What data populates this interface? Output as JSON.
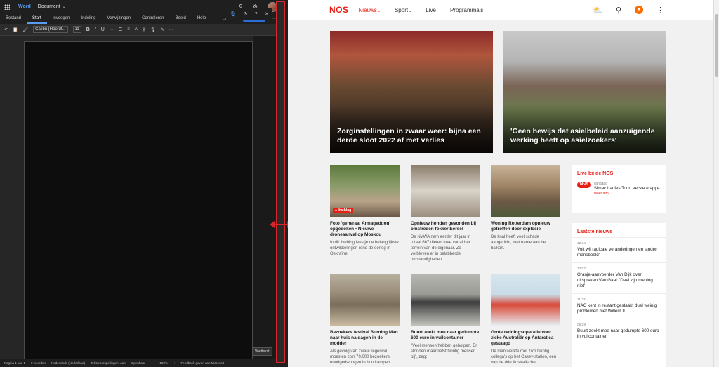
{
  "word": {
    "app_name": "Word",
    "doc_title": "Document",
    "tabs": [
      "Bestand",
      "Start",
      "Invoegen",
      "Indeling",
      "Verwijzingen",
      "Controleren",
      "Beeld",
      "Help"
    ],
    "active_tab": "Start",
    "share_label": "Delen",
    "font_name": "Calibri (Hoofdt...",
    "font_size": "11",
    "footer_button": "Voettekst",
    "status": {
      "page": "Pagina 1 van 1",
      "words": "0 woorden",
      "language": "Nederlands (Nederland)",
      "predictions": "Tekstvoorspellingen: Aan",
      "focus": "Openbaar",
      "zoom": "100%",
      "feedback": "Feedback geven aan Microsoft"
    }
  },
  "nos": {
    "logo": "NOS",
    "nav": [
      {
        "label": "Nieuws",
        "has_dropdown": true,
        "active": true
      },
      {
        "label": "Sport",
        "has_dropdown": true,
        "active": false
      },
      {
        "label": "Live",
        "has_dropdown": false,
        "active": false
      },
      {
        "label": "Programma's",
        "has_dropdown": false,
        "active": false
      }
    ],
    "icons": [
      "weather-icon",
      "search-icon",
      "npo-icon",
      "more-icon"
    ],
    "accent_color": "#e61e14",
    "heroes": [
      {
        "title": "Zorginstellingen in zwaar weer: bijna een derde sloot 2022 af met verlies"
      },
      {
        "title": "'Geen bewijs dat asielbeleid aanzuigende werking heeft op asielzoekers'"
      }
    ],
    "cards": [
      {
        "title": "Foto 'generaal Armageddon' opgedoken • Nieuwe droneaanval op Moskou",
        "text": "In dit liveblog lees je de belangrijkste ontwikkelingen rond de oorlog in Oekraïne.",
        "badge": "liveblog"
      },
      {
        "title": "Opnieuw honden gevonden bij omstreden fokker Eersel",
        "text": "De NVWA nam eerder dit jaar in totaal 667 dieren mee vanaf het terrein van de eigenaar. Ze verbleven er in belabberde omstandigheden.",
        "badge": ""
      },
      {
        "title": "Woning Rotterdam opnieuw getroffen door explosie",
        "text": "De knal heeft veel schade aangericht, met name aan het balkon.",
        "badge": ""
      },
      {
        "title": "Bezoekers festival Burning Man naar huis na dagen in de modder",
        "text": "Als gevolg van zware regenval moesten zo'n 70.000 bezoekers noodgedwongen in hun kampen",
        "badge": ""
      },
      {
        "title": "Buurt zoekt mee naar gedumpte 600 euro in vuilcontainer",
        "text": "\"Veel mensen hebben geholpen. Er stonden maar liefst twintig mensen bij\", zegt",
        "badge": ""
      },
      {
        "title": "Grote reddingsoperatie voor zieke Australiër op Antarctica gestaagd",
        "text": "De man werkte met zo'n twintig collega's op het Casey-station, een van de drie Australische",
        "badge": ""
      }
    ],
    "live": {
      "heading": "Live bij de NOS",
      "time": "14:45",
      "when": "vandaag",
      "title": "Simac Ladies Tour: eerste etappe",
      "more": "Meer info"
    },
    "latest": {
      "heading": "Laatste nieuws",
      "items": [
        {
          "time": "12:14",
          "title": "Volt wil radicale veranderingen en 'ander mensbeeld'"
        },
        {
          "time": "12:07",
          "title": "Oranje-aanvoerder Van Dijk over uitspraken Van Gaal: 'Deel zijn mening niet'"
        },
        {
          "time": "11:32",
          "title": "NAC kent in restant gestaakt duel weinig problemen met Willem II"
        },
        {
          "time": "09:29",
          "title": "Buurt zoekt mee naar gedumpte 600 euro in vuilcontainer"
        }
      ]
    }
  }
}
